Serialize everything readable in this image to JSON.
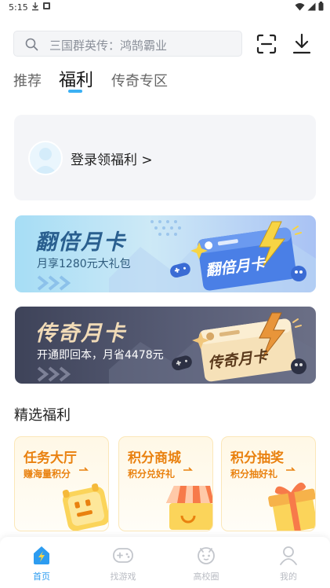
{
  "status_bar": {
    "time": "5:15"
  },
  "search": {
    "placeholder": "三国群英传：鸿鹄霸业"
  },
  "tabs": [
    {
      "label": "推荐",
      "active": false
    },
    {
      "label": "福利",
      "active": true
    },
    {
      "label": "传奇专区",
      "active": false
    }
  ],
  "login": {
    "text": "登录领福利 >"
  },
  "banners": [
    {
      "title": "翻倍月卡",
      "subtitle": "月享1280元大礼包",
      "card_text": "翻倍月卡"
    },
    {
      "title": "传奇月卡",
      "subtitle": "开通即回本，月省4478元",
      "card_text": "传奇月卡"
    }
  ],
  "section": {
    "title": "精选福利"
  },
  "features": [
    {
      "title": "任务大厅",
      "subtitle": "赚海量积分"
    },
    {
      "title": "积分商城",
      "subtitle": "积分兑好礼"
    },
    {
      "title": "积分抽奖",
      "subtitle": "积分抽好礼"
    }
  ],
  "bottom_nav": [
    {
      "label": "首页",
      "active": true
    },
    {
      "label": "找游戏",
      "active": false
    },
    {
      "label": "高校圈",
      "active": false
    },
    {
      "label": "我的",
      "active": false
    }
  ],
  "colors": {
    "accent": "#3bb0f3",
    "feature_orange": "#e9810f",
    "nav_active": "#2d9cf0"
  }
}
